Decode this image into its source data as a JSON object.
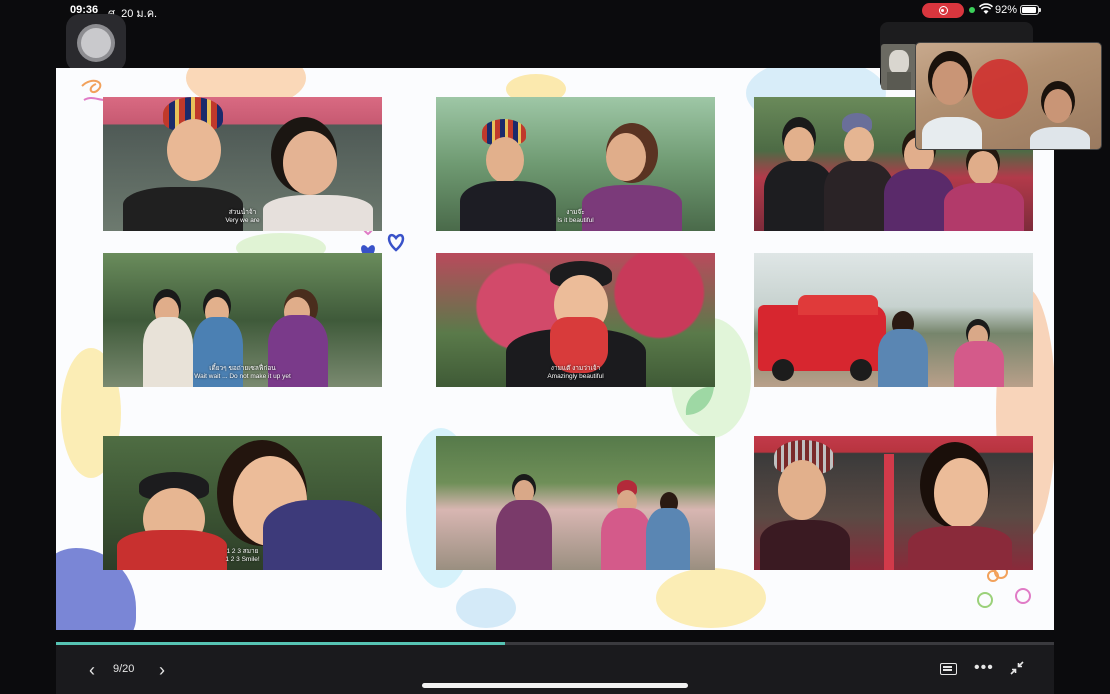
{
  "status": {
    "time": "09:36",
    "date": "ศ. 20 ม.ค.",
    "battery": "92%",
    "battery_level": 0.92,
    "colors": {
      "record": "#d9363e",
      "mic_dot": "#3cd05a"
    }
  },
  "slide": {
    "photos": [
      {
        "subtitle_th": "ส่วนน่ำจ้า",
        "subtitle_en": "Very we are"
      },
      {
        "subtitle_th": "งามจ๊ะ",
        "subtitle_en": "Is it beautiful"
      },
      {
        "subtitle_th": "",
        "subtitle_en": ""
      },
      {
        "subtitle_th": "เดี๋ยวๆ ขอถ่ายเซลฟี่ก่อน",
        "subtitle_en": "Wait wait ... Do not make it up yet"
      },
      {
        "subtitle_th": "งามแต๊ งามว่าเจ้า",
        "subtitle_en": "Amazingly beautiful"
      },
      {
        "subtitle_th": "",
        "subtitle_en": ""
      },
      {
        "subtitle_th": "1 2 3 สมาย",
        "subtitle_en": "1 2 3 Smile!"
      },
      {
        "subtitle_th": "",
        "subtitle_en": ""
      },
      {
        "subtitle_th": "",
        "subtitle_en": ""
      }
    ]
  },
  "player": {
    "page": "9/20",
    "progress": 0.45,
    "prev_icon": "‹",
    "next_icon": "›",
    "more_icon": "•••",
    "icons": [
      "chevron-left-icon",
      "chevron-right-icon",
      "keyboard-icon",
      "more-icon",
      "collapse-icon"
    ],
    "accent": "#56c3b3"
  }
}
